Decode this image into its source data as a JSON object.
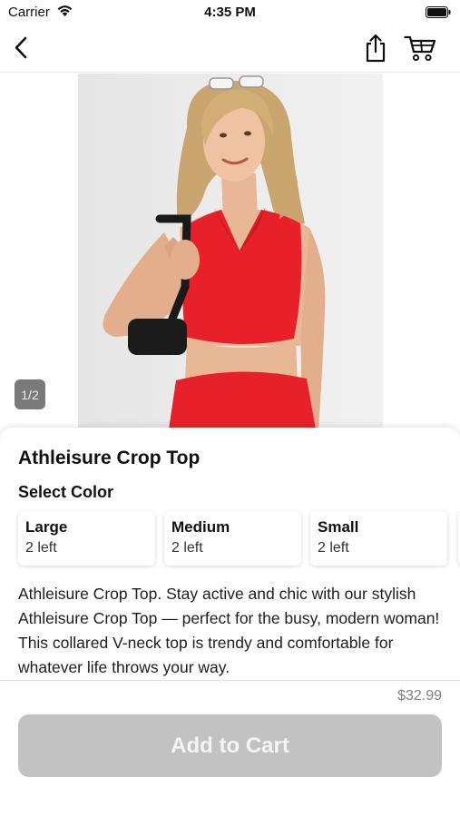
{
  "status_bar": {
    "carrier": "Carrier",
    "time": "4:35 PM",
    "icons": [
      "wifi-icon",
      "battery-icon"
    ]
  },
  "nav": {
    "icons": [
      "chevron-left-icon",
      "share-icon",
      "cart-icon"
    ]
  },
  "gallery": {
    "page_indicator": "1/2",
    "image": "product-photo-woman-red-crop-top"
  },
  "product": {
    "title": "Athleisure Crop Top",
    "select_label": "Select Color",
    "options": [
      {
        "label": "Large",
        "stock": "2 left"
      },
      {
        "label": "Medium",
        "stock": "2 left"
      },
      {
        "label": "Small",
        "stock": "2 left"
      }
    ],
    "description": "Athleisure Crop Top. Stay active and chic with our stylish Athleisure Crop Top — perfect for the busy, modern woman! This collared V-neck top is trendy and comfortable for whatever life throws your way.",
    "price": "$32.99"
  },
  "actions": {
    "add_to_cart": "Add to Cart"
  },
  "colors": {
    "button_disabled": "#c2c2c2",
    "product_red": "#e8202a"
  }
}
